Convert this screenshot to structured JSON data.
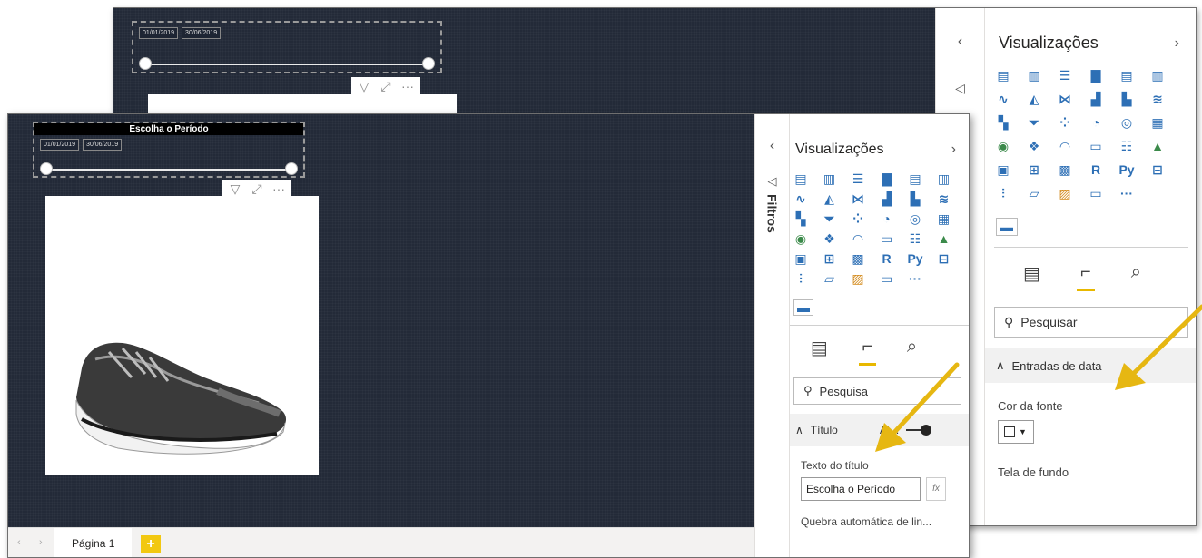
{
  "slicer": {
    "title": "Escolha o Período",
    "start_date": "01/01/2019",
    "end_date": "30/06/2019"
  },
  "filters_label": "Filtros",
  "viz": {
    "title": "Visualizações",
    "r_label": "R",
    "py_label": "Py",
    "more": "···",
    "search_placeholder": "Pesquisar",
    "search_text_front": "Pesquisa"
  },
  "format_back": {
    "section": "Entradas de data",
    "font_color_label": "Cor da fonte",
    "background_label": "Tela de fundo"
  },
  "format_front": {
    "section": "Título",
    "toggle_label": "At...",
    "title_text_label": "Texto do título",
    "title_text_value": "Escolha o Período",
    "fx_label": "fx",
    "wrap_label": "Quebra automática de lin..."
  },
  "pages": {
    "page1": "Página 1",
    "add": "+"
  },
  "colors": {
    "canvas": "#232a38",
    "accent": "#e8b800",
    "arrow": "#e6b712"
  }
}
